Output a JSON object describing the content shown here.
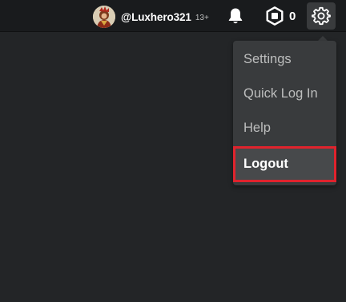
{
  "header": {
    "username": "@Luxhero321",
    "age_badge": "13+",
    "robux_count": "0",
    "icons": {
      "avatar": "avatar-image",
      "notifications": "bell-icon",
      "currency": "robux-icon",
      "settings": "gear-icon"
    }
  },
  "settings_menu": {
    "items": [
      {
        "label": "Settings"
      },
      {
        "label": "Quick Log In"
      },
      {
        "label": "Help"
      },
      {
        "label": "Logout",
        "highlighted": true
      }
    ]
  },
  "colors": {
    "background": "#232527",
    "topbar": "#191b1d",
    "menu": "#393b3d",
    "highlight_border": "#e0232d"
  }
}
